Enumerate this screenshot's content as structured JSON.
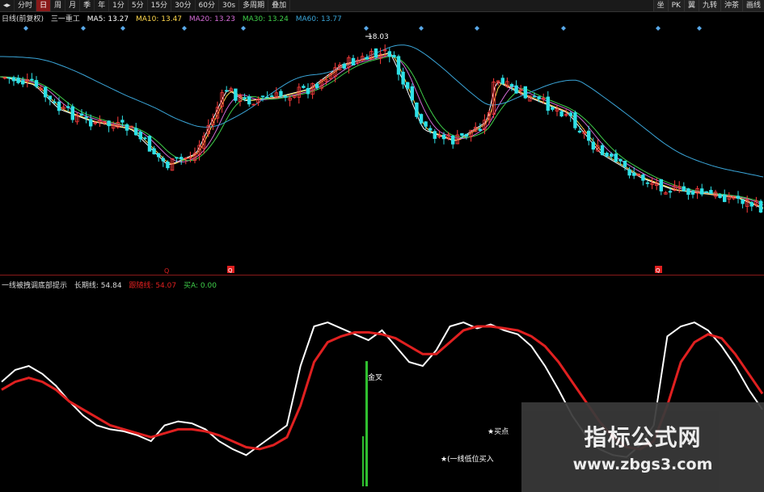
{
  "toolbar": {
    "items": [
      "分时",
      "日",
      "周",
      "月",
      "季",
      "年",
      "1分",
      "5分",
      "15分",
      "30分",
      "60分",
      "30s",
      "多周期",
      "叠加"
    ],
    "active_index": 1,
    "right_items": [
      "坐",
      "PK",
      "翼",
      "九转",
      "沖茶",
      "画线"
    ]
  },
  "main_info": {
    "title": "日线(前复权)",
    "indicator": "三一重工",
    "ma5": "MA5: 13.27",
    "ma10": "MA10: 13.47",
    "ma20": "MA20: 13.23",
    "ma30": "MA30: 13.24",
    "ma60": "MA60: 13.77"
  },
  "sub_info": {
    "name": "一线被拽调底部提示",
    "long_line": "长期线: 54.84",
    "follow_line": "跟随线: 54.07",
    "buy": "买A: 0.00"
  },
  "annotations": {
    "peak_price": "18.03",
    "callout_jinchang": "金叉",
    "callout_buy": "★买点",
    "callout_tip": "★(一线低位买入"
  },
  "markers": {
    "q1": "Q",
    "q2": "Q",
    "q3": "Q"
  },
  "watermark": {
    "line1": "指标公式网",
    "line2": "www.zbgs3.com"
  },
  "colors": {
    "up": "#ff3b3b",
    "down": "#2ee0e6",
    "ma5": "#ffffff",
    "ma10": "#ffd84d",
    "ma20": "#d46bd6",
    "ma30": "#3fcf4a",
    "ma60": "#3aa5d8",
    "white_line": "#ffffff",
    "red_line": "#e02020",
    "bar": "#2fbf2f",
    "diamond": "#58a8e8"
  },
  "chart_data": {
    "type": "line",
    "series": [
      {
        "name": "长期线",
        "values": [
          52,
          58,
          60,
          56,
          50,
          42,
          35,
          30,
          28,
          27,
          25,
          22,
          30,
          32,
          31,
          28,
          22,
          18,
          15,
          20,
          25,
          30,
          60,
          80,
          82,
          79,
          76,
          73,
          78,
          70,
          62,
          60,
          68,
          80,
          82,
          79,
          81,
          78,
          76,
          70,
          60,
          48,
          35,
          25,
          18,
          15,
          14,
          20,
          30,
          75,
          80,
          82,
          78,
          70,
          60,
          48,
          38
        ]
      },
      {
        "name": "跟随线",
        "values": [
          48,
          52,
          54,
          52,
          48,
          42,
          38,
          34,
          30,
          28,
          26,
          24,
          26,
          28,
          28,
          27,
          25,
          22,
          19,
          18,
          20,
          24,
          40,
          62,
          72,
          75,
          77,
          77,
          76,
          74,
          70,
          66,
          66,
          72,
          78,
          80,
          80,
          79,
          78,
          75,
          70,
          62,
          52,
          42,
          32,
          24,
          19,
          18,
          22,
          40,
          62,
          72,
          76,
          74,
          66,
          56,
          46
        ]
      }
    ]
  }
}
